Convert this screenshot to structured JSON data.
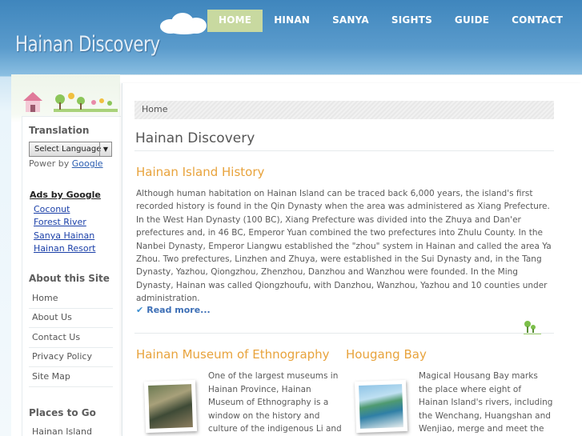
{
  "header": {
    "logo": "Hainan Discovery",
    "nav": [
      "HOME",
      "HINAN",
      "SANYA",
      "SIGHTS",
      "GUIDE",
      "CONTACT"
    ],
    "active_nav": 0
  },
  "sidebar": {
    "translation_heading": "Translation",
    "language_select": "Select Language",
    "powered_by": "Power by",
    "powered_link": "Google",
    "ads_title": "Ads by Google",
    "ads": [
      "Coconut",
      "Forest River",
      "Sanya Hainan",
      "Hainan Resort"
    ],
    "about_heading": "About this Site",
    "about_items": [
      "Home",
      "About Us",
      "Contact Us",
      "Privacy Policy",
      "Site Map"
    ],
    "places_heading": "Places to Go",
    "places_items": [
      "Hainan Island"
    ]
  },
  "main": {
    "breadcrumb": "Home",
    "page_title": "Hainan Discovery",
    "history_title": "Hainan Island History",
    "history_text": "Although human habitation on Hainan Island can be traced back 6,000 years, the island's first recorded history is found in the Qin Dynasty when the area was administered as Xiang Prefecture. In the West Han Dynasty (100 BC), Xiang Prefecture was divided into the Zhuya and Dan'er prefectures and, in 46 BC, Emperor Yuan combined the two prefectures into Zhulu County. In the Nanbei Dynasty, Emperor Liangwu established the \"zhou\" system in Hainan and called the area Ya Zhou. Two prefectures, Linzhen and Zhuya, were established in the Sui Dynasty and, in the Tang Dynasty, Yazhou, Qiongzhou, Zhenzhou, Danzhou and Wanzhou were founded. In the Ming Dynasty, Hainan was called Qiongzhoufu, with Danzhou, Wanzhou, Yazhou and 10 counties under administration.",
    "read_more": "Read more...",
    "museum_title": "Hainan Museum of Ethnography",
    "museum_text": "One of the largest museums in Hainan Province, Hainan Museum of Ethnography is a window on the history and culture of the indigenous Li and Miao",
    "bay_title": "Hougang Bay",
    "bay_text": "Magical Housang Bay marks the place where eight of Hainan Island's rivers, including the Wenchang, Huangshan and Wenjiao, merge and meet the"
  },
  "colors": {
    "accent_title": "#e8a33c",
    "nav_active": "#c8d9a0",
    "link": "#1a3fa8"
  }
}
